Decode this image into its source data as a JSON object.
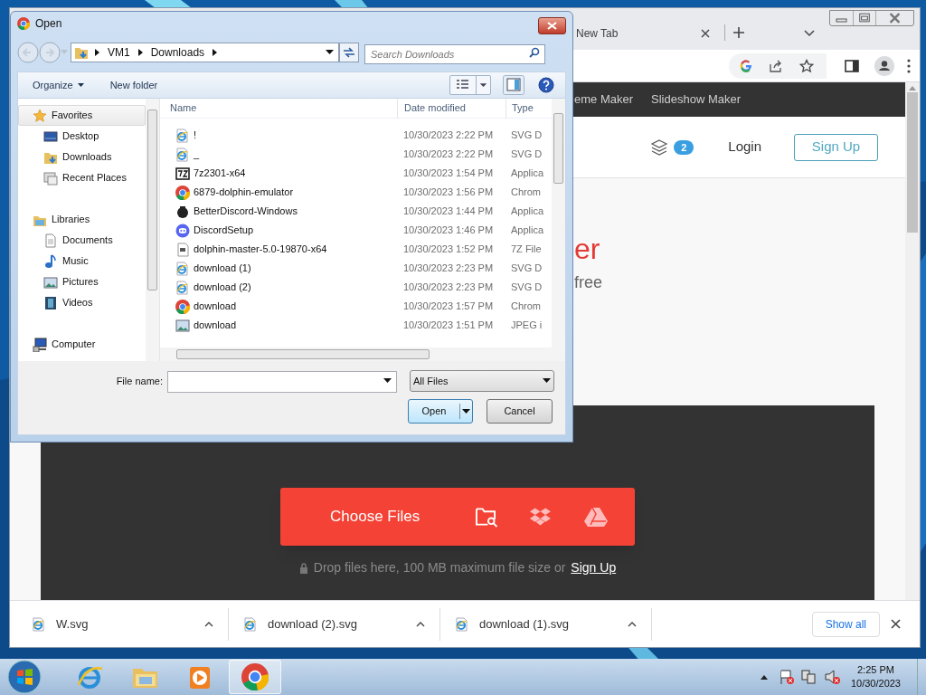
{
  "browser": {
    "tabs": [
      {
        "label": "New Tab"
      }
    ],
    "nav_links": [
      "eme Maker",
      "Slideshow Maker"
    ],
    "header": {
      "badge": "2",
      "login": "Login",
      "signup": "Sign Up"
    },
    "hero": {
      "title": "er",
      "subtitle": "free"
    },
    "upload": {
      "button": "Choose Files",
      "note": "Drop files here, 100 MB maximum file size or",
      "link": "Sign Up"
    },
    "downloads": [
      {
        "name": "W.svg"
      },
      {
        "name": "download (2).svg"
      },
      {
        "name": "download (1).svg"
      }
    ],
    "show_all": "Show all"
  },
  "dialog": {
    "title": "Open",
    "breadcrumb": [
      "VM1",
      "Downloads"
    ],
    "search": {
      "placeholder": "Search Downloads"
    },
    "toolbar": [
      "Organize",
      "New folder"
    ],
    "nav": [
      {
        "label": "Favorites",
        "kind": "favorites",
        "selected": true,
        "children": [
          {
            "label": "Desktop",
            "kind": "desktop",
            "selected": false
          },
          {
            "label": "Downloads",
            "kind": "downloads",
            "selected": false
          },
          {
            "label": "Recent Places",
            "kind": "recent",
            "selected": false
          }
        ]
      },
      {
        "label": "Libraries",
        "kind": "libraries",
        "selected": false,
        "children": [
          {
            "label": "Documents",
            "kind": "documents",
            "selected": false
          },
          {
            "label": "Music",
            "kind": "music",
            "selected": false
          },
          {
            "label": "Pictures",
            "kind": "pictures",
            "selected": false
          },
          {
            "label": "Videos",
            "kind": "videos",
            "selected": false
          }
        ]
      },
      {
        "label": "Computer",
        "kind": "computer",
        "selected": false
      }
    ],
    "columns": [
      "Name",
      "Date modified",
      "Type"
    ],
    "files": [
      {
        "name": "!",
        "date": "10/30/2023 2:22 PM",
        "type": "SVG D",
        "kind": "svg"
      },
      {
        "name": "_",
        "date": "10/30/2023 2:22 PM",
        "type": "SVG D",
        "kind": "svg"
      },
      {
        "name": "7z2301-x64",
        "date": "10/30/2023 1:54 PM",
        "type": "Applica",
        "kind": "sevenzip"
      },
      {
        "name": "6879-dolphin-emulator",
        "date": "10/30/2023 1:56 PM",
        "type": "Chrom",
        "kind": "chrome"
      },
      {
        "name": "BetterDiscord-Windows",
        "date": "10/30/2023 1:44 PM",
        "type": "Applica",
        "kind": "bd"
      },
      {
        "name": "DiscordSetup",
        "date": "10/30/2023 1:46 PM",
        "type": "Applica",
        "kind": "discord"
      },
      {
        "name": "dolphin-master-5.0-19870-x64",
        "date": "10/30/2023 1:52 PM",
        "type": "7Z File",
        "kind": "archive"
      },
      {
        "name": "download (1)",
        "date": "10/30/2023 2:23 PM",
        "type": "SVG D",
        "kind": "svg"
      },
      {
        "name": "download (2)",
        "date": "10/30/2023 2:23 PM",
        "type": "SVG D",
        "kind": "svg"
      },
      {
        "name": "download",
        "date": "10/30/2023 1:57 PM",
        "type": "Chrom",
        "kind": "chrome"
      },
      {
        "name": "download",
        "date": "10/30/2023 1:51 PM",
        "type": "JPEG i",
        "kind": "image"
      }
    ],
    "file_name_label": "File name:",
    "filter": "All Files",
    "buttons": [
      "Open",
      "Cancel"
    ]
  },
  "taskbar": {
    "apps": [
      {
        "kind": "ie",
        "selected": false
      },
      {
        "kind": "explorer",
        "selected": false
      },
      {
        "kind": "media",
        "selected": false
      },
      {
        "kind": "chrome",
        "selected": true
      }
    ],
    "time": "2:25 PM",
    "date": "10/30/2023"
  }
}
